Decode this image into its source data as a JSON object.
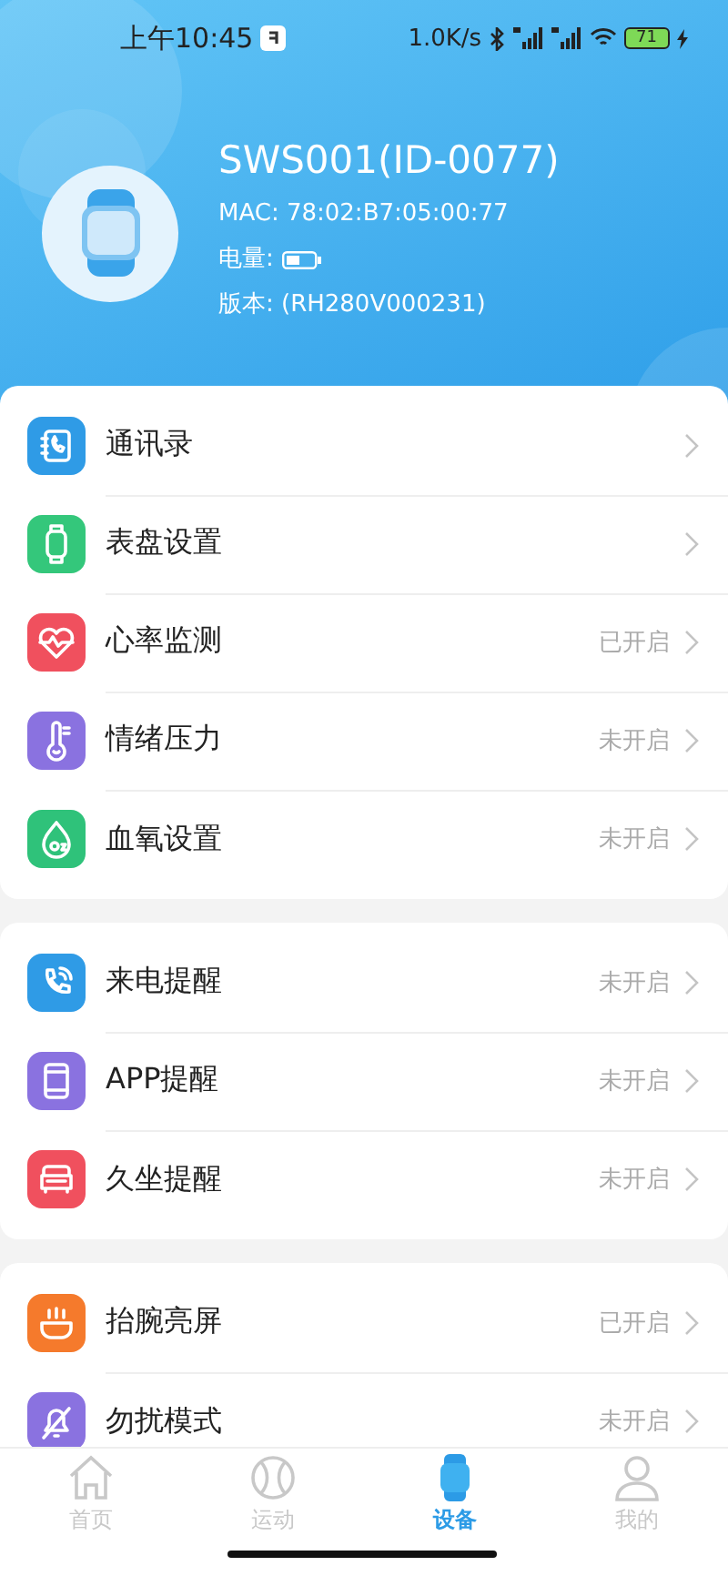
{
  "status_bar": {
    "time": "上午10:45",
    "speed": "1.0K/s",
    "battery": "71"
  },
  "device": {
    "name": "SWS001(ID-0077)",
    "mac": "MAC: 78:02:B7:05:00:77",
    "battery_label": "电量:",
    "version": "版本: (RH280V000231)"
  },
  "groups": [
    {
      "items": [
        {
          "label": "通讯录",
          "kind": "contacts",
          "color": "#2f9be6"
        },
        {
          "label": "表盘设置",
          "kind": "watch",
          "color": "#34c77b"
        },
        {
          "label": "心率监测",
          "kind": "heart",
          "color": "#f0505e",
          "status": "已开启"
        },
        {
          "label": "情绪压力",
          "kind": "thermometer",
          "color": "#8a72e0",
          "status": "未开启"
        },
        {
          "label": "血氧设置",
          "kind": "oxygen",
          "color": "#2fc27a",
          "status": "未开启"
        }
      ]
    },
    {
      "items": [
        {
          "label": "来电提醒",
          "kind": "call",
          "color": "#2f9be6",
          "status": "未开启"
        },
        {
          "label": "APP提醒",
          "kind": "phone",
          "color": "#8a72e0",
          "status": "未开启"
        },
        {
          "label": "久坐提醒",
          "kind": "sofa",
          "color": "#f0505e",
          "status": "未开启"
        }
      ]
    },
    {
      "items": [
        {
          "label": "抬腕亮屏",
          "kind": "raise",
          "color": "#f57a2c",
          "status": "已开启"
        },
        {
          "label": "勿扰模式",
          "kind": "bell-off",
          "color": "#8a72e0",
          "status": "未开启"
        }
      ]
    }
  ],
  "tabs": [
    {
      "label": "首页",
      "kind": "home",
      "selected": false
    },
    {
      "label": "运动",
      "kind": "ball",
      "selected": false
    },
    {
      "label": "设备",
      "kind": "watch",
      "selected": true
    },
    {
      "label": "我的",
      "kind": "person",
      "selected": false
    }
  ]
}
